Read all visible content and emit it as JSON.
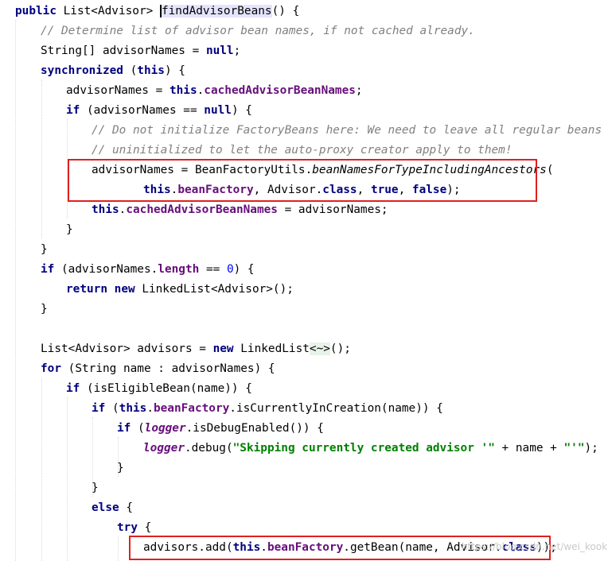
{
  "editor": {
    "colors": {
      "keyword": "#000080",
      "field": "#660e7a",
      "comment": "#808080",
      "string": "#008000",
      "number": "#0000ff",
      "highlight_box": "#e02020"
    },
    "tokens": {
      "t1": "public",
      "t2": " List<Advisor> ",
      "t3": "findAdvisorBeans",
      "t4": "() {",
      "t5": "// Determine list of advisor bean names, if not cached already.",
      "t6": "String[] advisorNames = ",
      "t7": "null",
      "t8": ";",
      "t9": "synchronized",
      "t10": " (",
      "t11": "this",
      "t12": ") {",
      "t13": "advisorNames = ",
      "t14": "this",
      "t15": ".",
      "t16": "cachedAdvisorBeanNames",
      "t17": ";",
      "t18": "if",
      "t19": " (advisorNames == ",
      "t20": "null",
      "t21": ") {",
      "t22": "// Do not initialize FactoryBeans here: We need to leave all regular beans",
      "t23": "// uninitialized to let the auto-proxy creator apply to them!",
      "t24": "advisorNames = BeanFactoryUtils.",
      "t25": "beanNamesForTypeIncludingAncestors",
      "t26": "(",
      "t27": "this",
      "t28": ".",
      "t29": "beanFactory",
      "t30": ", Advisor.",
      "t31": "class",
      "t32": ", ",
      "t33": "true",
      "t34": ", ",
      "t35": "false",
      "t36": ");",
      "t37": "this",
      "t38": ".",
      "t39": "cachedAdvisorBeanNames",
      "t40": " = advisorNames;",
      "t41": "}",
      "t42": "}",
      "t43": "if",
      "t44": " (advisorNames.",
      "t45": "length",
      "t46": " == ",
      "t47": "0",
      "t48": ") {",
      "t49": "return",
      "t50": " ",
      "t51": "new",
      "t52": " LinkedList<Advisor>();",
      "t53": "}",
      "t54": "List<Advisor> advisors = ",
      "t55": "new",
      "t56": " LinkedList",
      "t57": "<~>",
      "t58": "();",
      "t59": "for",
      "t60": " (String name : advisorNames) {",
      "t61": "if",
      "t62": " (isEligibleBean(name)) {",
      "t63": "if",
      "t64": " (",
      "t65": "this",
      "t66": ".",
      "t67": "beanFactory",
      "t68": ".isCurrentlyInCreation(name)) {",
      "t69": "if",
      "t70": " (",
      "t71": "logger",
      "t72": ".isDebugEnabled()) {",
      "t73": "logger",
      "t74": ".debug(",
      "t75": "\"Skipping currently created advisor '\"",
      "t76": " + name + ",
      "t77": "\"'\"",
      "t78": ");",
      "t79": "}",
      "t80": "}",
      "t81": "else",
      "t82": " {",
      "t83": "try",
      "t84": " {",
      "t85": "advisors.add(",
      "t86": "this",
      "t87": ".",
      "t88": "beanFactory",
      "t89": ".getBean(name, Advisor.",
      "t90": "class",
      "t91": "));"
    }
  },
  "watermark": {
    "text": "https://blog.csdn.net/wei_kook"
  }
}
